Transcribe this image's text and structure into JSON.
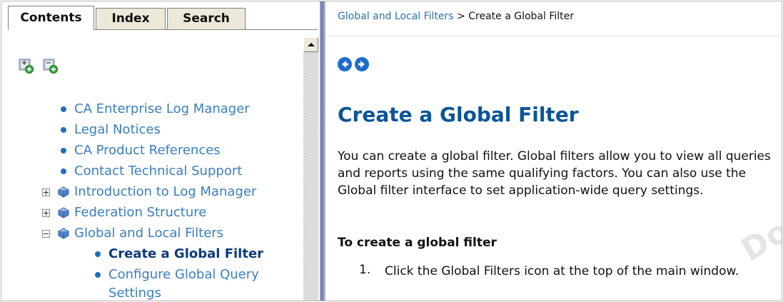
{
  "tabs": [
    {
      "label": "Contents",
      "active": true
    },
    {
      "label": "Index",
      "active": false
    },
    {
      "label": "Search",
      "active": false
    }
  ],
  "toolbar": {
    "expand_all_icon": "expand-all-icon",
    "collapse_all_icon": "collapse-all-icon"
  },
  "tree": {
    "items": [
      {
        "label": "CA Enterprise Log Manager",
        "kind": "topic"
      },
      {
        "label": "Legal Notices",
        "kind": "topic"
      },
      {
        "label": "CA Product References",
        "kind": "topic"
      },
      {
        "label": "Contact Technical Support",
        "kind": "topic"
      },
      {
        "label": "Introduction to Log Manager",
        "kind": "book",
        "state": "collapsed"
      },
      {
        "label": "Federation Structure",
        "kind": "book",
        "state": "collapsed"
      },
      {
        "label": "Global and Local Filters",
        "kind": "book",
        "state": "expanded"
      },
      {
        "label": "Create a Global Filter",
        "kind": "topic",
        "current": true
      },
      {
        "label": "Configure Global Query",
        "kind": "topic"
      },
      {
        "label": "Settings",
        "kind": "topic-continuation"
      }
    ]
  },
  "breadcrumb": {
    "link": "Global and Local Filters",
    "separator": ">",
    "current": "Create a Global Filter"
  },
  "nav": {
    "back_icon": "back-arrow-icon",
    "forward_icon": "forward-arrow-icon"
  },
  "content": {
    "title": "Create a Global Filter",
    "intro": "You can create a global filter. Global filters allow you to view all queries and reports using the same qualifying factors. You can also use the Global filter interface to set application-wide query settings.",
    "procedure_heading": "To create a global filter",
    "steps": [
      {
        "number": "1.",
        "text": "Click the Global Filters icon at the top of the main window."
      }
    ]
  },
  "watermark": "Docu",
  "colors": {
    "link": "#3a7ec0",
    "title": "#0b5596",
    "accent": "#1e6dcc"
  }
}
